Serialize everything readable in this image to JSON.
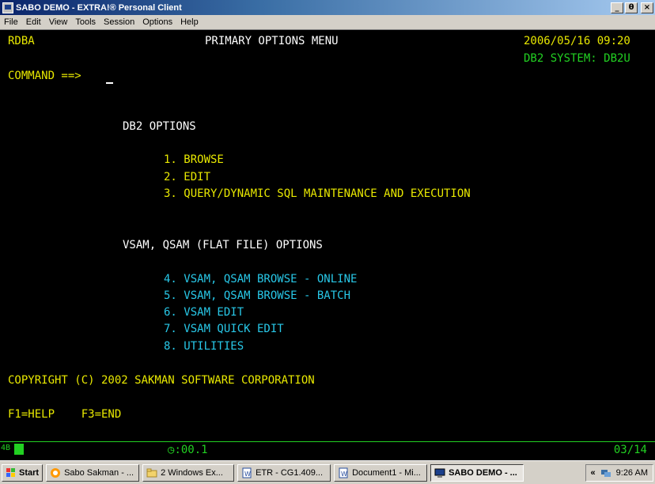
{
  "window": {
    "title": "SABO DEMO - EXTRA!® Personal Client",
    "controls": [
      "_",
      "θ",
      "×"
    ]
  },
  "menu": [
    "File",
    "Edit",
    "View",
    "Tools",
    "Session",
    "Options",
    "Help"
  ],
  "screen": {
    "userid": "RDBA",
    "title": "PRIMARY OPTIONS MENU",
    "datetime": "2006/05/16 09:20",
    "system": "DB2 SYSTEM: DB2U",
    "command_label": "COMMAND ==>",
    "db2_header": "DB2 OPTIONS",
    "db2_options": [
      "1. BROWSE",
      "2. EDIT",
      "3. QUERY/DYNAMIC SQL MAINTENANCE AND EXECUTION"
    ],
    "vsam_header": "VSAM, QSAM (FLAT FILE) OPTIONS",
    "vsam_options": [
      "4. VSAM, QSAM BROWSE - ONLINE",
      "5. VSAM, QSAM BROWSE - BATCH",
      "6. VSAM EDIT",
      "7. VSAM QUICK EDIT",
      "8. UTILITIES"
    ],
    "copyright": "COPYRIGHT (C) 2002 SAKMAN SOFTWARE CORPORATION",
    "pfkeys": "F1=HELP    F3=END"
  },
  "status": {
    "indicator": "4B",
    "timer": ":00.1",
    "cursor_pos": "03/14"
  },
  "taskbar": {
    "start": "Start",
    "tasks": [
      "Sabo Sakman - ...",
      "2 Windows Ex...",
      "ETR - CG1.409...",
      "Document1 - Mi...",
      "SABO DEMO - ..."
    ],
    "tray_arrows": "«",
    "clock": "9:26 AM"
  }
}
